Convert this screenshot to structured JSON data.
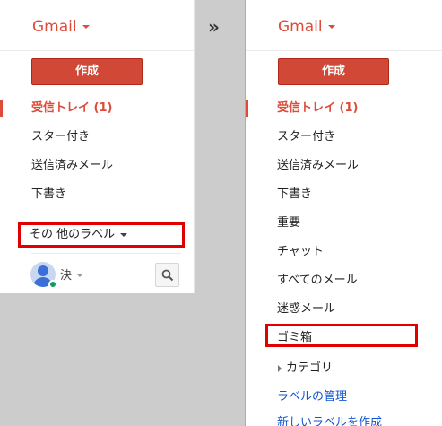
{
  "left": {
    "title": "Gmail",
    "compose_label": "作成",
    "nav": [
      {
        "label": "受信トレイ (1)",
        "active": true
      },
      {
        "label": "スター付き"
      },
      {
        "label": "送信済みメール"
      },
      {
        "label": "下書き"
      }
    ],
    "more_labels": "その 他のラベル",
    "user_name": "決"
  },
  "transition_arrow": "»",
  "right": {
    "title": "Gmail",
    "compose_label": "作成",
    "nav": [
      {
        "label": "受信トレイ (1)",
        "active": true
      },
      {
        "label": "スター付き"
      },
      {
        "label": "送信済みメール"
      },
      {
        "label": "下書き"
      },
      {
        "label": "重要"
      },
      {
        "label": "チャット"
      },
      {
        "label": "すべてのメール"
      },
      {
        "label": "迷惑メール"
      },
      {
        "label": "ゴミ箱",
        "highlighted": true
      },
      {
        "label": "カテゴリ",
        "expandable": true
      },
      {
        "label": "ラベルの管理",
        "link": true
      },
      {
        "label": "新しいラベルを作成",
        "link": true
      }
    ]
  },
  "colors": {
    "accent": "#dd4b39",
    "compose": "#d14836",
    "highlight_box": "#e00000",
    "link": "#1155cc"
  },
  "icons": [
    "caret-down-icon",
    "avatar-icon",
    "search-icon",
    "triangle-right-icon"
  ]
}
